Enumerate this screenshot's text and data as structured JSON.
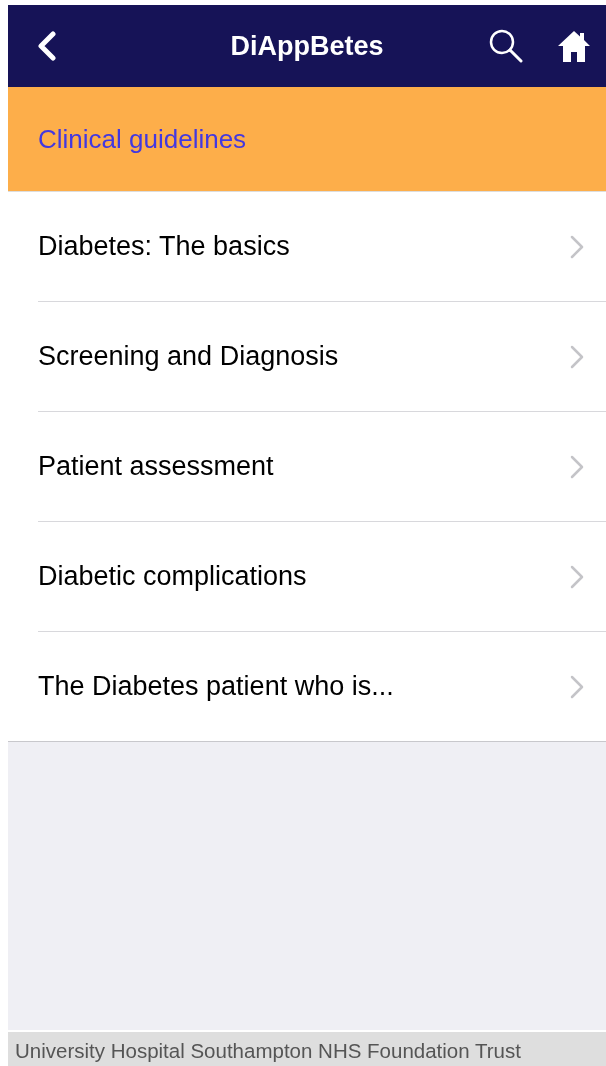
{
  "header": {
    "title": "DiAppBetes"
  },
  "section": {
    "title": "Clinical guidelines"
  },
  "menu": {
    "items": [
      {
        "label": "Diabetes: The basics"
      },
      {
        "label": "Screening and Diagnosis"
      },
      {
        "label": "Patient assessment"
      },
      {
        "label": "Diabetic complications"
      },
      {
        "label": "The Diabetes patient who is..."
      }
    ]
  },
  "footer": {
    "text": "University Hospital Southampton NHS Foundation Trust"
  }
}
